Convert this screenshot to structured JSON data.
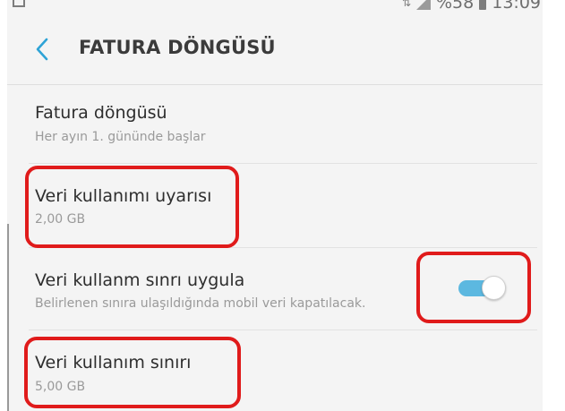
{
  "status_bar": {
    "battery": "%58",
    "time": "13:09"
  },
  "header": {
    "title": "FATURA DÖNGÜSÜ",
    "back_icon": "chevron-left-icon"
  },
  "settings": [
    {
      "title": "Fatura döngüsü",
      "subtitle": "Her ayın 1. gününde başlar"
    },
    {
      "title": "Veri kullanımı uyarısı",
      "subtitle": "2,00 GB"
    },
    {
      "title": "Veri kullanm sınrı uygula",
      "subtitle": "Belirlenen sınıra ulaşıldığında mobil veri kapatılacak.",
      "toggle_on": true
    },
    {
      "title": "Veri kullanım sınırı",
      "subtitle": "5,00 GB"
    }
  ],
  "colors": {
    "accent": "#2ea3d6",
    "toggle_track": "#5cb8e0",
    "highlight": "#e01b1b"
  }
}
